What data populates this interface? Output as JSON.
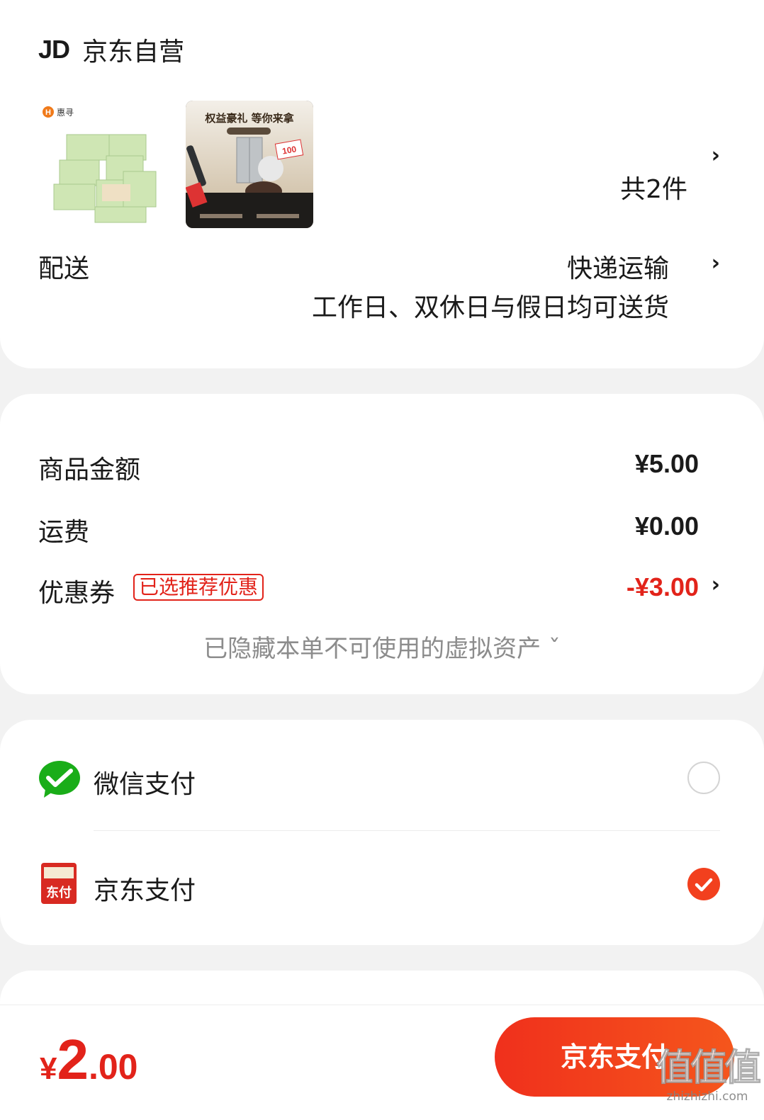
{
  "shop": {
    "logo": "JD",
    "name": "京东自营",
    "item_count": "共2件",
    "product_images": [
      {
        "icon": "tissue-pack-image",
        "brand": "惠寻"
      },
      {
        "icon": "midea-promo-image",
        "headline": "权益豪礼 等你来拿",
        "badge": "100"
      }
    ]
  },
  "delivery": {
    "label": "配送",
    "method": "快递运输",
    "note": "工作日、双休日与假日均可送货"
  },
  "amounts": {
    "goods_label": "商品金额",
    "goods_value": "¥5.00",
    "shipping_label": "运费",
    "shipping_value": "¥0.00",
    "coupon_label": "优惠券",
    "coupon_tag": "已选推荐优惠",
    "coupon_value": "-¥3.00",
    "hidden_note": "已隐藏本单不可使用的虚拟资产 ˇ"
  },
  "payment": {
    "options": [
      {
        "label": "微信支付",
        "icon": "wechat-pay-icon",
        "selected": false
      },
      {
        "label": "京东支付",
        "icon": "jd-pay-icon",
        "icon_text": "东付",
        "selected": true
      }
    ]
  },
  "footer": {
    "currency": "¥",
    "total_int": "2",
    "total_dec": ".00",
    "pay_button": "京东支付"
  },
  "watermark": {
    "big": "值值值",
    "small": "zhizhizhi.com"
  },
  "colors": {
    "accent_red": "#e2231a",
    "button_gradient_start": "#f0301c",
    "button_gradient_end": "#f5561c",
    "wechat_green": "#1aad19"
  }
}
